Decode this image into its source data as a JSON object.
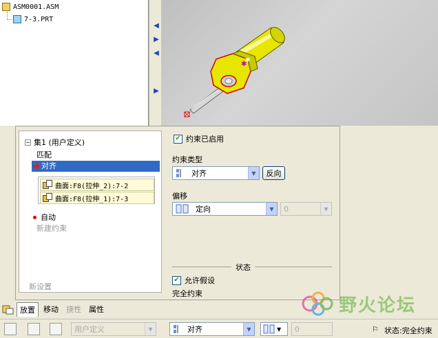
{
  "tree": {
    "root_label": "ASM0001.ASM",
    "child_label": "7-3.PRT"
  },
  "constraint_list": {
    "set_label": "集1 (用户定义)",
    "items": [
      "匹配",
      "对齐"
    ],
    "references": [
      "曲面:F8(拉伸_2):7-2",
      "曲面:F8(拉伸_1):7-3"
    ],
    "auto_label": "自动",
    "new_constraint_label": "新建约束",
    "new_set_label": "新设置"
  },
  "right_panel": {
    "enabled_label": "约束已启用",
    "type_heading": "约束类型",
    "type_value": "对齐",
    "flip_button": "反向",
    "offset_heading": "偏移",
    "offset_value": "定向",
    "offset_amount": "0",
    "status_heading": "状态",
    "allow_assumptions_label": "允许假设",
    "status_text": "完全约束"
  },
  "tabs": [
    "放置",
    "移动",
    "挠性",
    "属性"
  ],
  "bottom_toolbar": {
    "set_dropdown": "用户定义",
    "type_dropdown": "对齐",
    "offset_amount": "0",
    "status_text": "状态:完全约束"
  },
  "watermark": {
    "text": "野火论坛"
  },
  "colors": {
    "selection": "#316ac5",
    "part_yellow": "#e6e600",
    "highlight_red": "#d00000"
  }
}
